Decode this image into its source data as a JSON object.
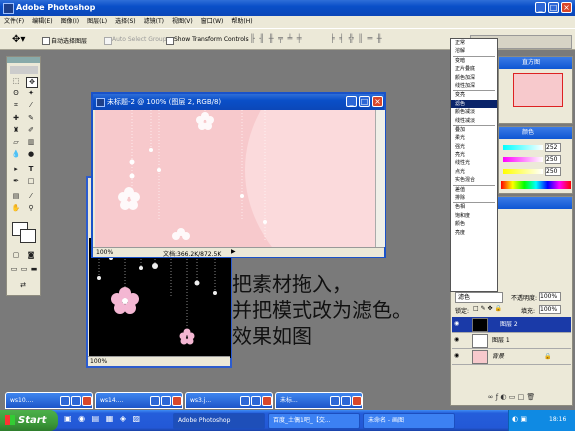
{
  "app_title": "Adobe Photoshop",
  "menu": [
    "文件(F)",
    "编辑(E)",
    "图像(I)",
    "图层(L)",
    "选择(S)",
    "滤镜(T)",
    "视图(V)",
    "窗口(W)",
    "帮助(H)"
  ],
  "options_bar": {
    "auto_select": "自动选择图层",
    "auto_select_groups": "Auto Select Groups",
    "show_transform": "Show Transform Controls"
  },
  "doc_window": {
    "title": "未标题-2 @ 100% (图层 2, RGB/8)",
    "zoom": "100%",
    "status": "文档:366.2K/872.5K"
  },
  "black_window": {
    "zoom": "100%"
  },
  "caption_lines": [
    "把素材拖入，",
    "并把模式改为滤色。",
    "效果如图"
  ],
  "blend_menu": {
    "items": [
      "正常",
      "溶解",
      "",
      "变暗",
      "正片叠底",
      "颜色加深",
      "线性加深",
      "",
      "变亮",
      "滤色",
      "颜色减淡",
      "线性减淡",
      "",
      "叠加",
      "柔光",
      "强光",
      "亮光",
      "线性光",
      "点光",
      "实色混合",
      "",
      "差值",
      "排除",
      "",
      "色相",
      "饱和度",
      "颜色",
      "亮度"
    ],
    "selected": "滤色"
  },
  "right_tabs": [
    "导航器",
    "信息",
    "直方图"
  ],
  "palette_tabs": [
    "颜色",
    "色板",
    "样式"
  ],
  "color_sliders": [
    {
      "label": "R",
      "value": "252"
    },
    {
      "label": "G",
      "value": "250"
    },
    {
      "label": "B",
      "value": "250"
    }
  ],
  "layers_panel": {
    "mode": "滤色",
    "opacity_label": "不透明度:",
    "opacity": "100%",
    "lock_label": "锁定:",
    "fill_label": "填充:",
    "fill": "100%",
    "layers": [
      {
        "name": "图层 2",
        "selected": true
      },
      {
        "name": "图层 1",
        "selected": false
      },
      {
        "name": "背景",
        "selected": false
      }
    ]
  },
  "minimized_windows": [
    "ws10....",
    "ws14....",
    "ws3.j...",
    "未标..."
  ],
  "taskbar": {
    "start": "Start",
    "buttons": [
      "Adobe Photoshop",
      "百度_土偶1吧_【交...",
      "未命名 - 画图"
    ],
    "clock": "18:16"
  },
  "colors": {
    "xp_blue": "#0a4fc8",
    "pink_canvas": "#f7c9cc",
    "taskbar_blue": "#245edb",
    "start_green": "#3c9a3a",
    "selected_blue": "#0a246a"
  }
}
